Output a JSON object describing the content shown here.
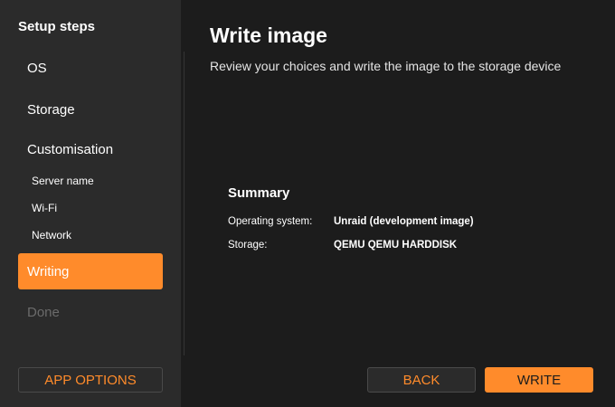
{
  "sidebar": {
    "title": "Setup steps",
    "steps": [
      {
        "label": "OS",
        "state": "default"
      },
      {
        "label": "Storage",
        "state": "default"
      },
      {
        "label": "Customisation",
        "state": "default"
      },
      {
        "label": "Server name",
        "state": "sub"
      },
      {
        "label": "Wi-Fi",
        "state": "sub"
      },
      {
        "label": "Network",
        "state": "sub"
      },
      {
        "label": "Writing",
        "state": "active"
      },
      {
        "label": "Done",
        "state": "disabled"
      }
    ],
    "app_options_label": "APP OPTIONS"
  },
  "main": {
    "title": "Write image",
    "subtitle": "Review your choices and write the image to the storage device",
    "summary": {
      "heading": "Summary",
      "rows": [
        {
          "key": "Operating system:",
          "value": "Unraid (development image)"
        },
        {
          "key": "Storage:",
          "value": "QEMU QEMU HARDDISK"
        }
      ]
    }
  },
  "footer": {
    "back_label": "BACK",
    "write_label": "WRITE"
  },
  "colors": {
    "accent": "#ff8b2b",
    "background": "#1c1c1c",
    "sidebar": "#2b2b2b",
    "disabled_text": "#6b6b6b"
  }
}
